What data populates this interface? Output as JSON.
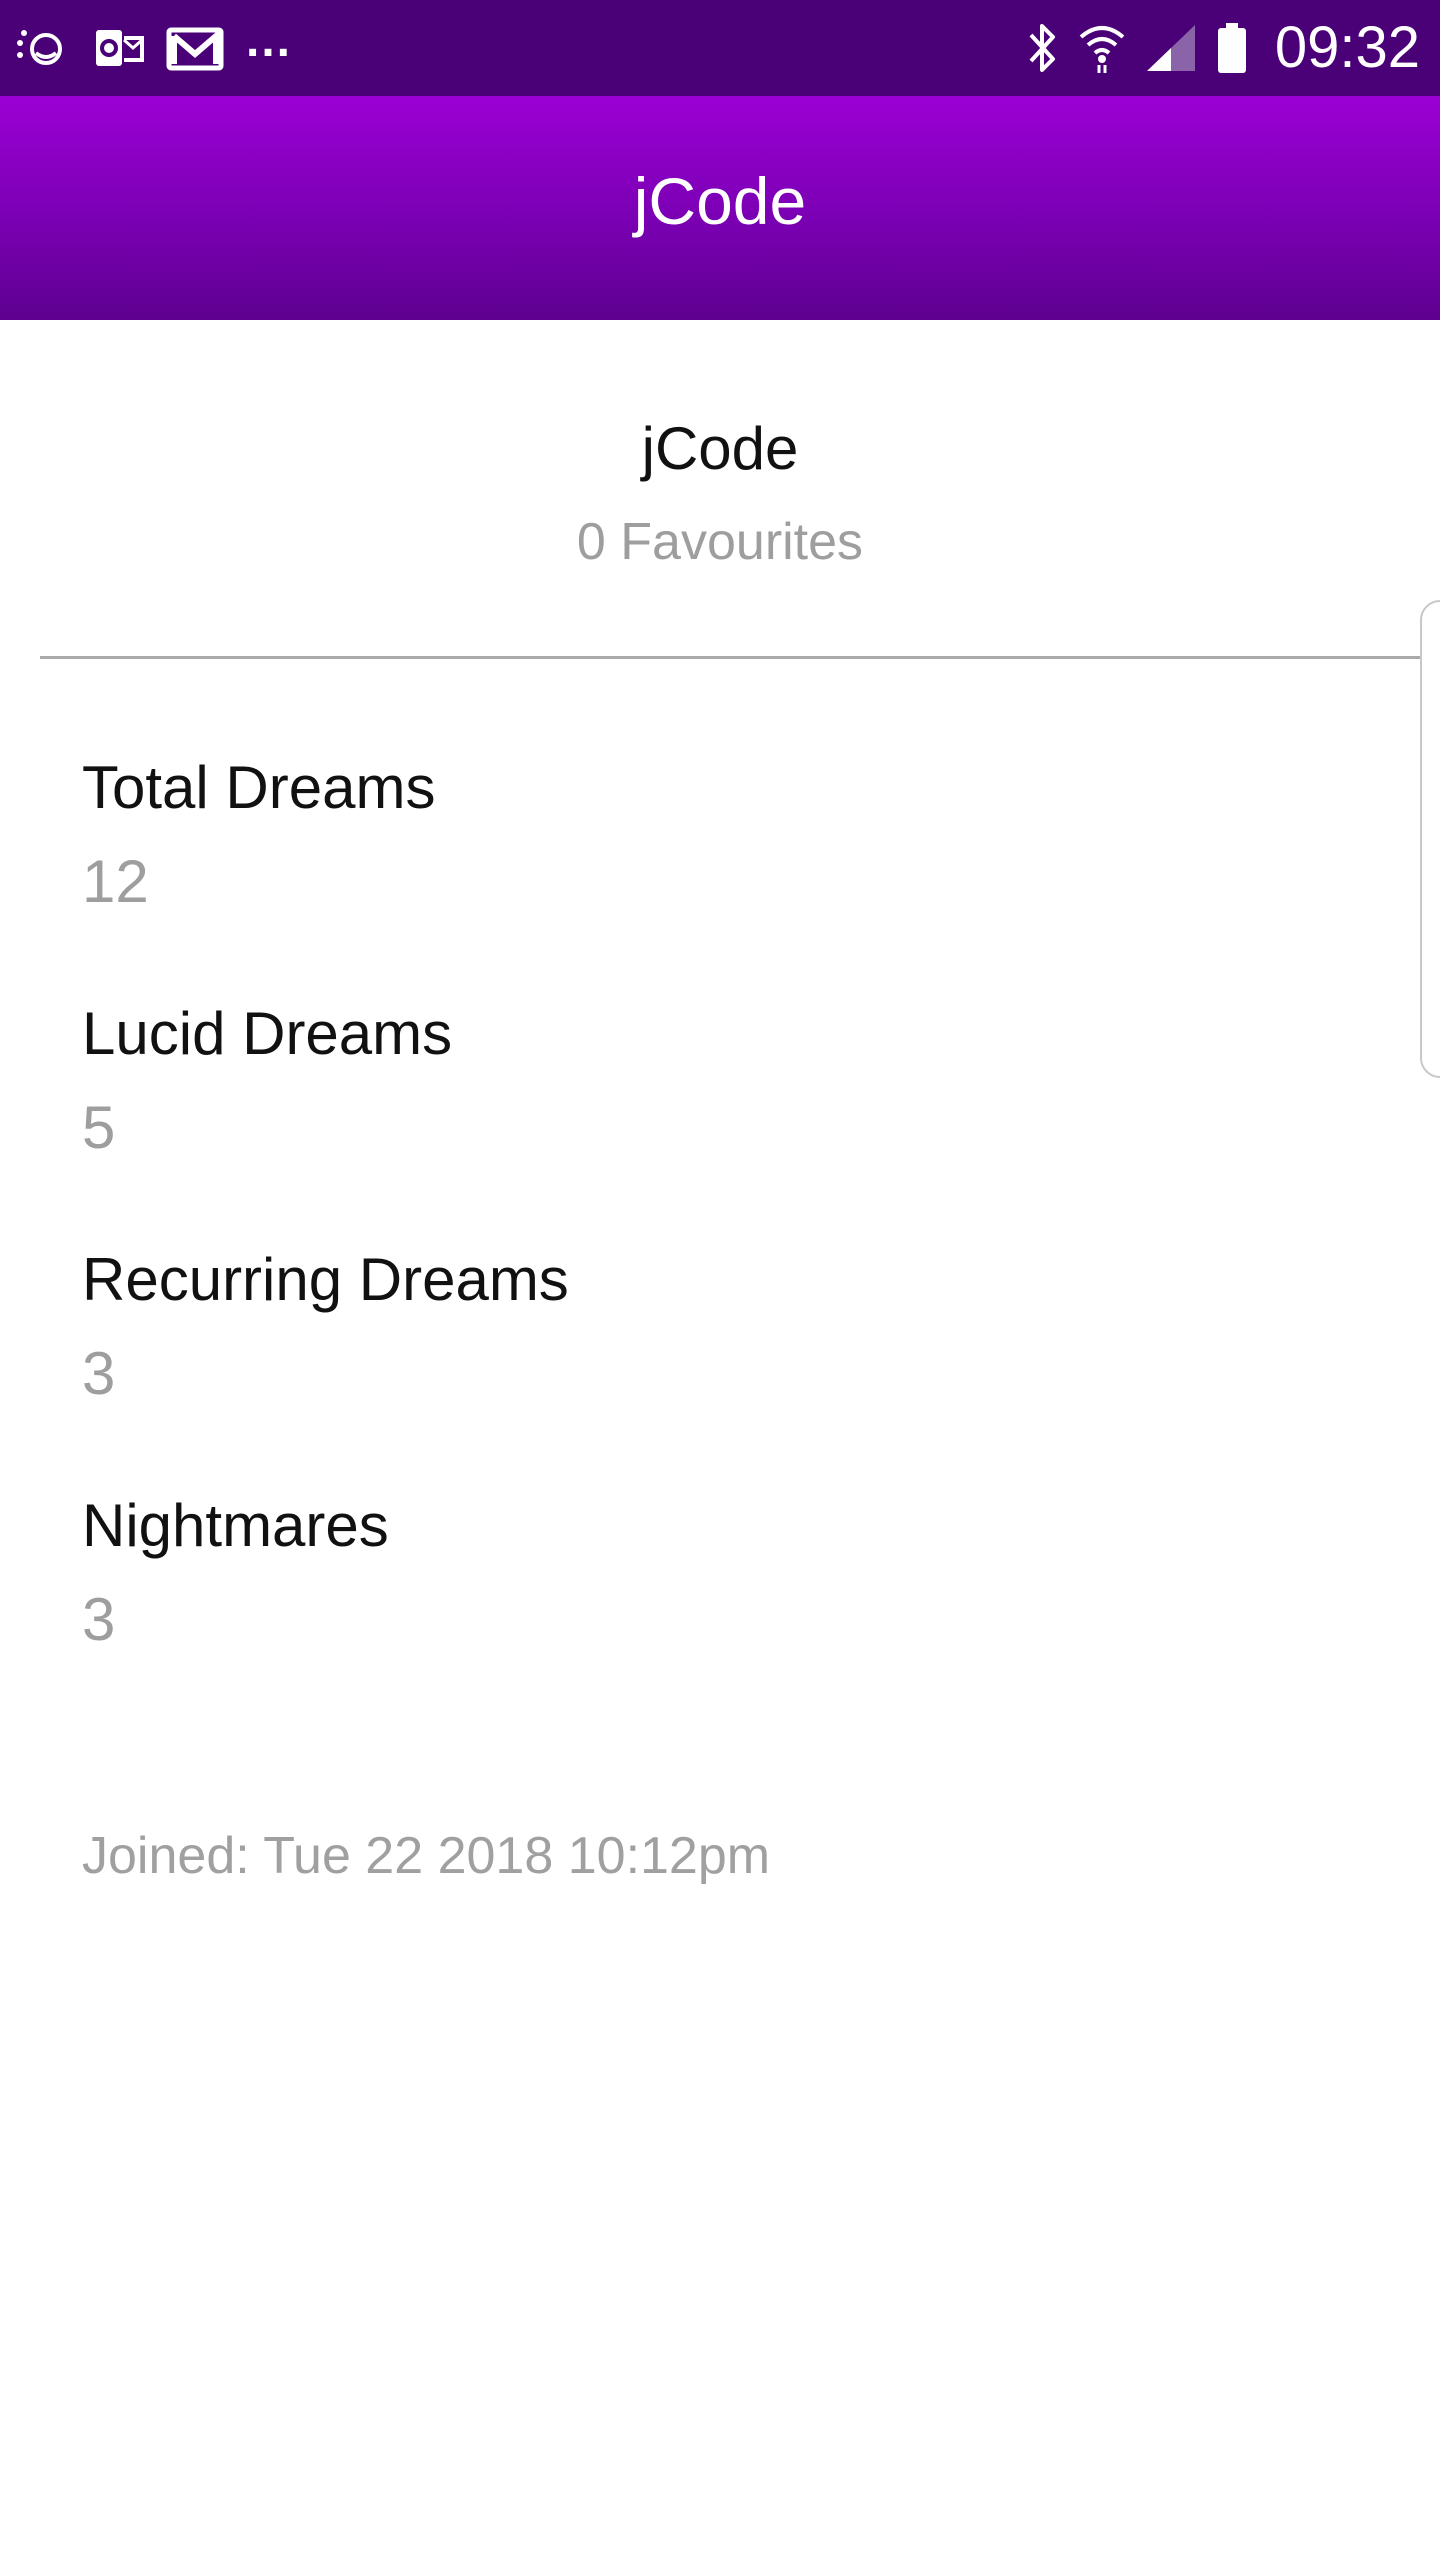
{
  "status_bar": {
    "icons_left": [
      "notification-icon",
      "outlook-icon",
      "gmail-icon"
    ],
    "more_indicator": "...",
    "icons_right": [
      "bluetooth-icon",
      "wifi-icon",
      "signal-icon",
      "battery-icon"
    ],
    "time": "09:32"
  },
  "app_bar": {
    "title": "jCode"
  },
  "profile": {
    "name": "jCode",
    "favourites": "0 Favourites"
  },
  "stats": [
    {
      "label": "Total Dreams",
      "value": "12"
    },
    {
      "label": "Lucid Dreams",
      "value": "5"
    },
    {
      "label": "Recurring Dreams",
      "value": "3"
    },
    {
      "label": "Nightmares",
      "value": "3"
    }
  ],
  "joined": "Joined: Tue 22 2018 10:12pm",
  "colors": {
    "status_bar": "#4a0077",
    "app_bar_top": "#9b00d4",
    "app_bar_bottom": "#5e0090",
    "secondary_text": "#9e9e9e"
  }
}
